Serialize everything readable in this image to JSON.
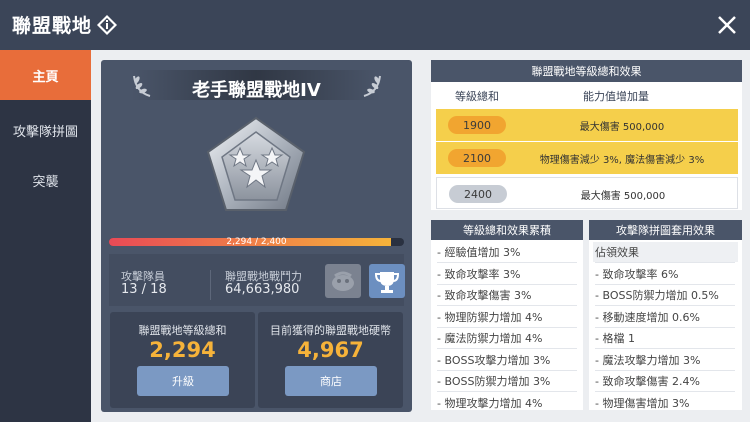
{
  "header": {
    "title": "聯盟戰地"
  },
  "sidebar": {
    "items": [
      {
        "label": "主頁",
        "active": true
      },
      {
        "label": "攻擊隊拼圖",
        "active": false
      },
      {
        "label": "突襲",
        "active": false
      }
    ]
  },
  "union": {
    "name": "老手聯盟戰地IV",
    "progress": {
      "text": "2,294 / 2,400",
      "current": 2294,
      "max": 2400
    },
    "attack_crew": {
      "label": "攻擊隊員",
      "value": "13 / 18"
    },
    "union_power": {
      "label": "聯盟戰地戰鬥力",
      "value": "64,663,980"
    },
    "level_total": {
      "label": "聯盟戰地等級總和",
      "value": "2,294",
      "button": "升級"
    },
    "coins": {
      "label": "目前獲得的聯盟戰地硬幣",
      "value": "4,967",
      "button": "商店"
    }
  },
  "level_effects": {
    "title": "聯盟戰地等級總和效果",
    "col_level": "等級總和",
    "col_effect": "能力值增加量",
    "rows": [
      {
        "level": "1900",
        "effect": "最大傷害 500,000",
        "reached": true
      },
      {
        "level": "2100",
        "effect": "物理傷害減少 3%, 魔法傷害減少 3%",
        "reached": true
      },
      {
        "level": "2400",
        "effect": "最大傷害 500,000",
        "reached": false
      }
    ]
  },
  "accumulated": {
    "title": "等級總和效果累積",
    "items": [
      "經驗值增加 3%",
      "致命攻擊率 3%",
      "致命攻擊傷害 3%",
      "物理防禦力增加 4%",
      "魔法防禦力增加 4%",
      "BOSS攻擊力增加 3%",
      "BOSS防禦力增加 3%",
      "物理攻擊力增加 4%"
    ]
  },
  "puzzle_effects": {
    "title": "攻擊隊拼圖套用效果",
    "items": [
      "佔領效果",
      "致命攻擊率 6%",
      "BOSS防禦力增加 0.5%",
      "移動速度增加 0.6%",
      "格檔 1",
      "魔法攻擊力增加 3%",
      "致命攻擊傷害 2.4%",
      "物理傷害增加 3%"
    ]
  },
  "colors": {
    "accent": "#e86d3a",
    "gold": "#f6b33a",
    "panel": "#4a5569"
  },
  "icons": {
    "info": "diamond-info-icon",
    "close": "close-icon",
    "trophy": "trophy-icon",
    "emblem": "pentagon-star-emblem"
  }
}
